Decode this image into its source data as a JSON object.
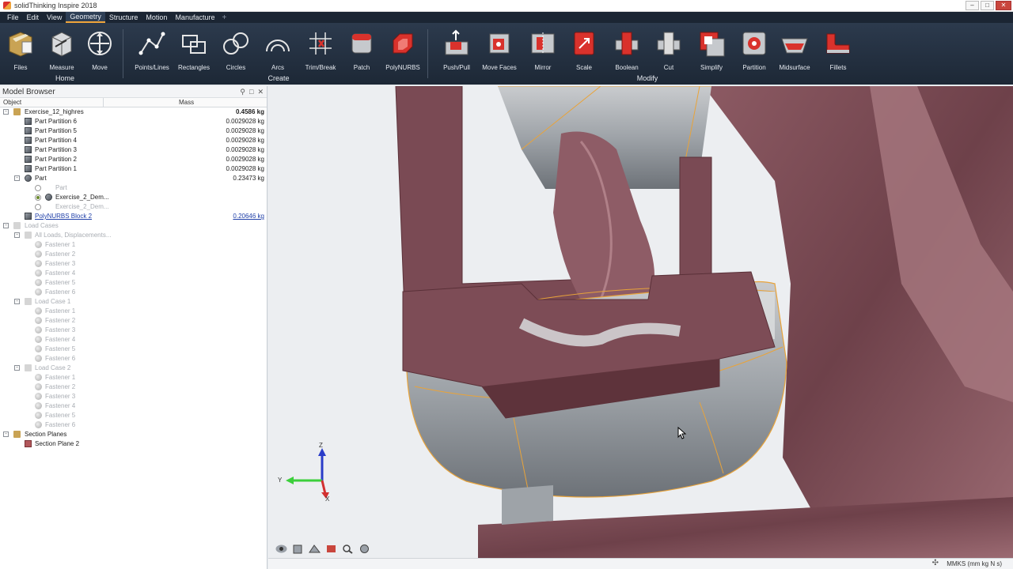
{
  "window": {
    "title": "solidThinking Inspire 2018"
  },
  "menu": [
    "File",
    "Edit",
    "View",
    "Geometry",
    "Structure",
    "Motion",
    "Manufacture"
  ],
  "menu_active": "Geometry",
  "ribbon": {
    "tools": [
      {
        "label": "Files",
        "icon": "files-icon"
      },
      {
        "label": "Measure",
        "icon": "measure-icon"
      },
      {
        "label": "Move",
        "icon": "move-icon"
      },
      {
        "label": "Points/Lines",
        "icon": "points-lines-icon"
      },
      {
        "label": "Rectangles",
        "icon": "rectangles-icon"
      },
      {
        "label": "Circles",
        "icon": "circles-icon"
      },
      {
        "label": "Arcs",
        "icon": "arcs-icon"
      },
      {
        "label": "Trim/Break",
        "icon": "trim-break-icon"
      },
      {
        "label": "Patch",
        "icon": "patch-icon"
      },
      {
        "label": "PolyNURBS",
        "icon": "polynurbs-icon"
      },
      {
        "label": "Push/Pull",
        "icon": "push-pull-icon"
      },
      {
        "label": "Move Faces",
        "icon": "move-faces-icon"
      },
      {
        "label": "Mirror",
        "icon": "mirror-icon"
      },
      {
        "label": "Scale",
        "icon": "scale-icon"
      },
      {
        "label": "Boolean",
        "icon": "boolean-icon"
      },
      {
        "label": "Cut",
        "icon": "cut-icon"
      },
      {
        "label": "Simplify",
        "icon": "simplify-icon"
      },
      {
        "label": "Partition",
        "icon": "partition-icon"
      },
      {
        "label": "Midsurface",
        "icon": "midsurface-icon"
      },
      {
        "label": "Fillets",
        "icon": "fillets-icon"
      }
    ],
    "groups": [
      "Home",
      "Create",
      "Modify"
    ]
  },
  "browser": {
    "title": "Model Browser",
    "columns": {
      "object": "Object",
      "mass": "Mass"
    },
    "rows": [
      {
        "name": "Exercise_12_highres",
        "mass": "0.4586 kg"
      },
      {
        "name": "Part Partition 6",
        "mass": "0.0029028 kg"
      },
      {
        "name": "Part Partition 5",
        "mass": "0.0029028 kg"
      },
      {
        "name": "Part Partition 4",
        "mass": "0.0029028 kg"
      },
      {
        "name": "Part Partition 3",
        "mass": "0.0029028 kg"
      },
      {
        "name": "Part Partition 2",
        "mass": "0.0029028 kg"
      },
      {
        "name": "Part Partition 1",
        "mass": "0.0029028 kg"
      },
      {
        "name": "Part",
        "mass": "0.23473 kg"
      },
      {
        "name": "Part",
        "mass": ""
      },
      {
        "name": "Exercise_2_Dem...",
        "mass": ""
      },
      {
        "name": "Exercise_2_Dem...",
        "mass": ""
      },
      {
        "name": "PolyNURBS Block 2",
        "mass": "0.20646 kg"
      },
      {
        "name": "Load Cases",
        "mass": ""
      },
      {
        "name": "All Loads, Displacements...",
        "mass": ""
      },
      {
        "name": "Fastener 1",
        "mass": ""
      },
      {
        "name": "Fastener 2",
        "mass": ""
      },
      {
        "name": "Fastener 3",
        "mass": ""
      },
      {
        "name": "Fastener 4",
        "mass": ""
      },
      {
        "name": "Fastener 5",
        "mass": ""
      },
      {
        "name": "Fastener 6",
        "mass": ""
      },
      {
        "name": "Load Case 1",
        "mass": ""
      },
      {
        "name": "Fastener 1",
        "mass": ""
      },
      {
        "name": "Fastener 2",
        "mass": ""
      },
      {
        "name": "Fastener 3",
        "mass": ""
      },
      {
        "name": "Fastener 4",
        "mass": ""
      },
      {
        "name": "Fastener 5",
        "mass": ""
      },
      {
        "name": "Fastener 6",
        "mass": ""
      },
      {
        "name": "Load Case 2",
        "mass": ""
      },
      {
        "name": "Fastener 1",
        "mass": ""
      },
      {
        "name": "Fastener 2",
        "mass": ""
      },
      {
        "name": "Fastener 3",
        "mass": ""
      },
      {
        "name": "Fastener 4",
        "mass": ""
      },
      {
        "name": "Fastener 5",
        "mass": ""
      },
      {
        "name": "Fastener 6",
        "mass": ""
      },
      {
        "name": "Section Planes",
        "mass": ""
      },
      {
        "name": "Section Plane 2",
        "mass": ""
      }
    ]
  },
  "viewport": {
    "triad": {
      "x": "X",
      "y": "Y",
      "z": "Z"
    }
  },
  "status": {
    "units": "MMKS (mm kg N s)"
  },
  "colors": {
    "accent": "#f0a53a",
    "ribbon": "#1d2836",
    "mesh": "#7b4a55",
    "geometry": "#9ea3a8"
  }
}
